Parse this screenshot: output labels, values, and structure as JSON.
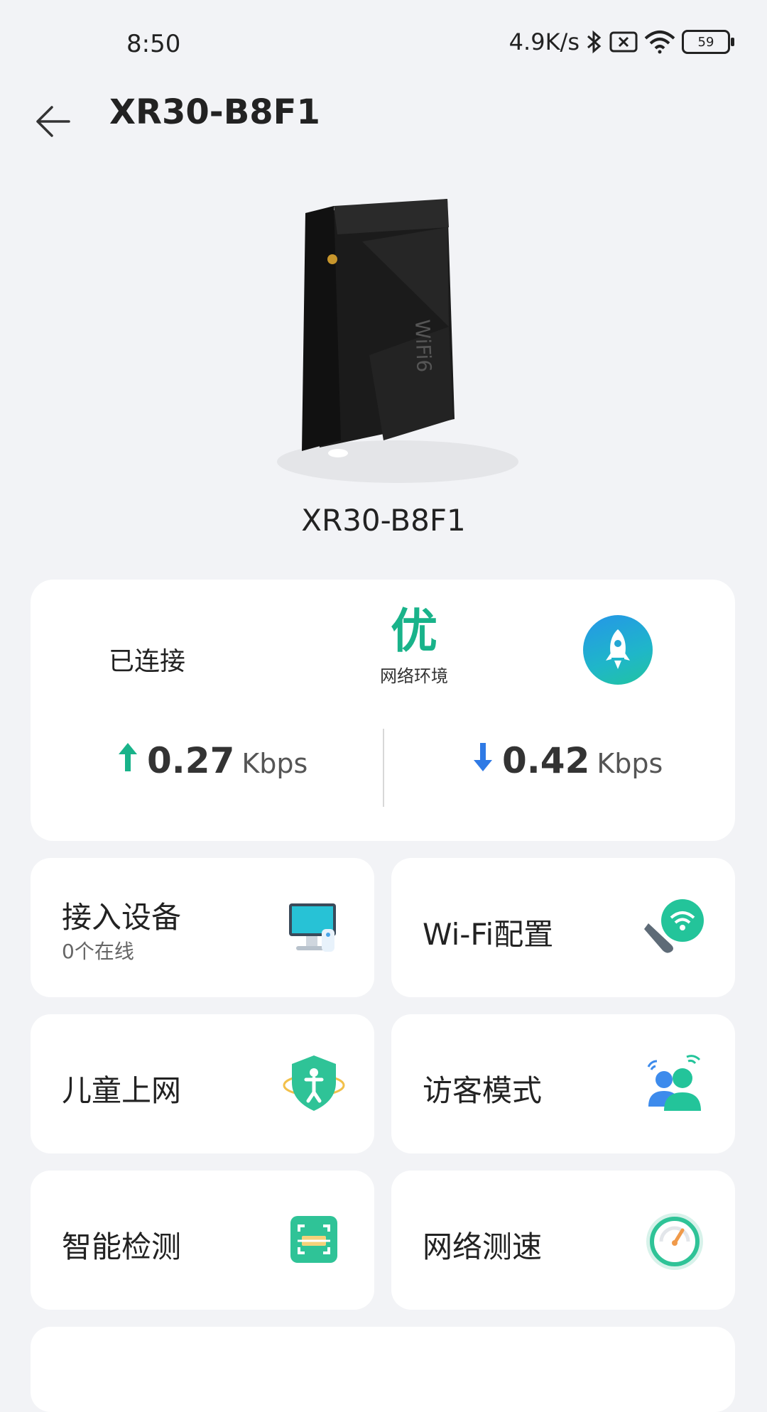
{
  "status_bar": {
    "time": "8:50",
    "net_speed": "4.9K/s",
    "battery": "59",
    "icons": [
      "bluetooth-icon",
      "sim-disabled-icon",
      "wifi-icon",
      "battery-icon"
    ]
  },
  "header": {
    "title": "XR30-B8F1",
    "back_icon": "arrow-left-icon"
  },
  "device": {
    "name": "XR30-B8F1",
    "image": "router-image"
  },
  "network": {
    "connected_label": "已连接",
    "quality_value": "优",
    "quality_label": "网络环境",
    "boost_icon": "rocket-icon",
    "upload": {
      "value": "0.27",
      "unit": "Kbps",
      "icon": "arrow-up-icon"
    },
    "download": {
      "value": "0.42",
      "unit": "Kbps",
      "icon": "arrow-down-icon"
    }
  },
  "tiles": [
    {
      "label": "接入设备",
      "sub": "0个在线",
      "icon": "computer-icon"
    },
    {
      "label": "Wi-Fi配置",
      "icon": "wifi-wrench-icon"
    },
    {
      "label": "儿童上网",
      "icon": "child-shield-icon"
    },
    {
      "label": "访客模式",
      "icon": "guest-users-icon"
    },
    {
      "label": "智能检测",
      "icon": "scan-box-icon"
    },
    {
      "label": "网络测速",
      "icon": "speedometer-icon"
    }
  ],
  "colors": {
    "accent": "#19b38a",
    "upload_arrow": "#19b38a",
    "download_arrow": "#2f7ae5",
    "background": "#f2f3f6"
  }
}
